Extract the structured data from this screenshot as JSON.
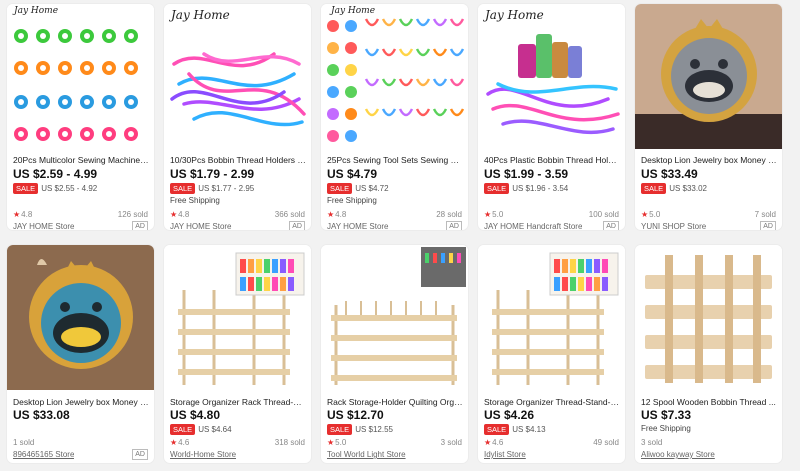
{
  "products": [
    {
      "brand": "Jay Home",
      "title": "20Pcs Multicolor Sewing Machine ...",
      "price": "US $2.59 - 4.99",
      "sale_label": "SALE",
      "sale_price": "US $2.55 - 4.92",
      "shipping": "",
      "rating": "4.8",
      "sold": "126 sold",
      "store": "JAY HOME Store",
      "ad": "AD"
    },
    {
      "brand": "Jay Home",
      "title": "10/30Pcs Bobbin Thread Holders S...",
      "price": "US $1.79 - 2.99",
      "sale_label": "SALE",
      "sale_price": "US $1.77 - 2.95",
      "shipping": "Free Shipping",
      "rating": "4.8",
      "sold": "366 sold",
      "store": "JAY HOME Store",
      "ad": "AD"
    },
    {
      "brand": "Jay Home",
      "title": "25Pcs Sewing Tool Sets Sewing Thr...",
      "price": "US $4.79",
      "sale_label": "SALE",
      "sale_price": "US $4.72",
      "shipping": "Free Shipping",
      "rating": "4.8",
      "sold": "28 sold",
      "store": "JAY HOME Store",
      "ad": "AD"
    },
    {
      "brand": "Jay Home",
      "title": "40Pcs Plastic Bobbin Thread Holde...",
      "price": "US $1.99 - 3.59",
      "sale_label": "SALE",
      "sale_price": "US $1.96 - 3.54",
      "shipping": "",
      "rating": "5.0",
      "sold": "100 sold",
      "store": "JAY HOME Handcraft Store",
      "ad": "AD"
    },
    {
      "brand": "",
      "title": "Desktop Lion Jewelry box Money b...",
      "price": "US $33.49",
      "sale_label": "SALE",
      "sale_price": "US $33.02",
      "shipping": "",
      "rating": "5.0",
      "sold": "7 sold",
      "store": "YUNI SHOP Store",
      "ad": "AD"
    },
    {
      "brand": "",
      "title": "Desktop Lion Jewelry box Money b...",
      "price": "US $33.08",
      "sale_label": "",
      "sale_price": "",
      "shipping": "",
      "rating": "",
      "sold": "1 sold",
      "store": "896465165 Store",
      "ad": "AD"
    },
    {
      "brand": "",
      "title": "Storage Organizer Rack Thread-Sta...",
      "price": "US $4.80",
      "sale_label": "SALE",
      "sale_price": "US $4.64",
      "shipping": "",
      "rating": "4.6",
      "sold": "318 sold",
      "store": "World-Home Store",
      "ad": ""
    },
    {
      "brand": "",
      "title": "Rack Storage-Holder Quilting Orga...",
      "price": "US $12.70",
      "sale_label": "SALE",
      "sale_price": "US $12.55",
      "shipping": "",
      "rating": "5.0",
      "sold": "3 sold",
      "store": "Tool World Light Store",
      "ad": ""
    },
    {
      "brand": "",
      "title": "Storage Organizer Thread-Stand-H...",
      "price": "US $4.26",
      "sale_label": "SALE",
      "sale_price": "US $4.13",
      "shipping": "",
      "rating": "4.6",
      "sold": "49 sold",
      "store": "Idylist Store",
      "ad": ""
    },
    {
      "brand": "",
      "title": "12 Spool Wooden Bobbin Thread ...",
      "price": "US $7.33",
      "sale_label": "",
      "sale_price": "",
      "shipping": "Free Shipping",
      "rating": "",
      "sold": "3 sold",
      "store": "Aliwoo kayway Store",
      "ad": ""
    }
  ],
  "colors": {
    "sale_badge": "#e62e2e",
    "star": "#e62e2e",
    "price": "#111111"
  },
  "icons": {
    "rating": "star-icon"
  }
}
